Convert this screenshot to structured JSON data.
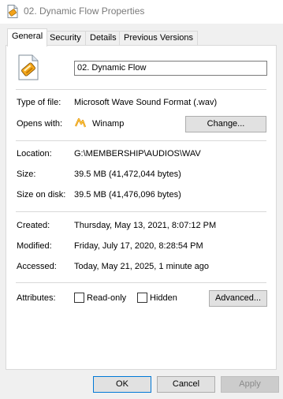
{
  "window": {
    "title": "02. Dynamic Flow Properties",
    "icon": "wav-file-icon"
  },
  "tabs": [
    {
      "label": "General",
      "active": true
    },
    {
      "label": "Security",
      "active": false
    },
    {
      "label": "Details",
      "active": false
    },
    {
      "label": "Previous Versions",
      "active": false
    }
  ],
  "general": {
    "file_name": "02. Dynamic Flow",
    "type_of_file_label": "Type of file:",
    "type_of_file": "Microsoft Wave Sound Format (.wav)",
    "opens_with_label": "Opens with:",
    "opens_with": "Winamp",
    "opens_with_icon": "winamp-icon",
    "change_button": "Change...",
    "location_label": "Location:",
    "location": "G:\\MEMBERSHIP\\AUDIOS\\WAV",
    "size_label": "Size:",
    "size": "39.5 MB (41,472,044 bytes)",
    "size_on_disk_label": "Size on disk:",
    "size_on_disk": "39.5 MB (41,476,096 bytes)",
    "created_label": "Created:",
    "created": "Thursday, May 13, 2021, 8:07:12 PM",
    "modified_label": "Modified:",
    "modified": "Friday, July 17, 2020, 8:28:54 PM",
    "accessed_label": "Accessed:",
    "accessed": "Today, May 21, 2025, 1 minute ago",
    "attributes_label": "Attributes:",
    "readonly_label": "Read-only",
    "readonly_checked": false,
    "hidden_label": "Hidden",
    "hidden_checked": false,
    "advanced_button": "Advanced..."
  },
  "footer": {
    "ok": "OK",
    "cancel": "Cancel",
    "apply": "Apply"
  },
  "colors": {
    "accent": "#0078d7",
    "panel_bg": "#ffffff",
    "window_bg": "#f0f0f0"
  }
}
